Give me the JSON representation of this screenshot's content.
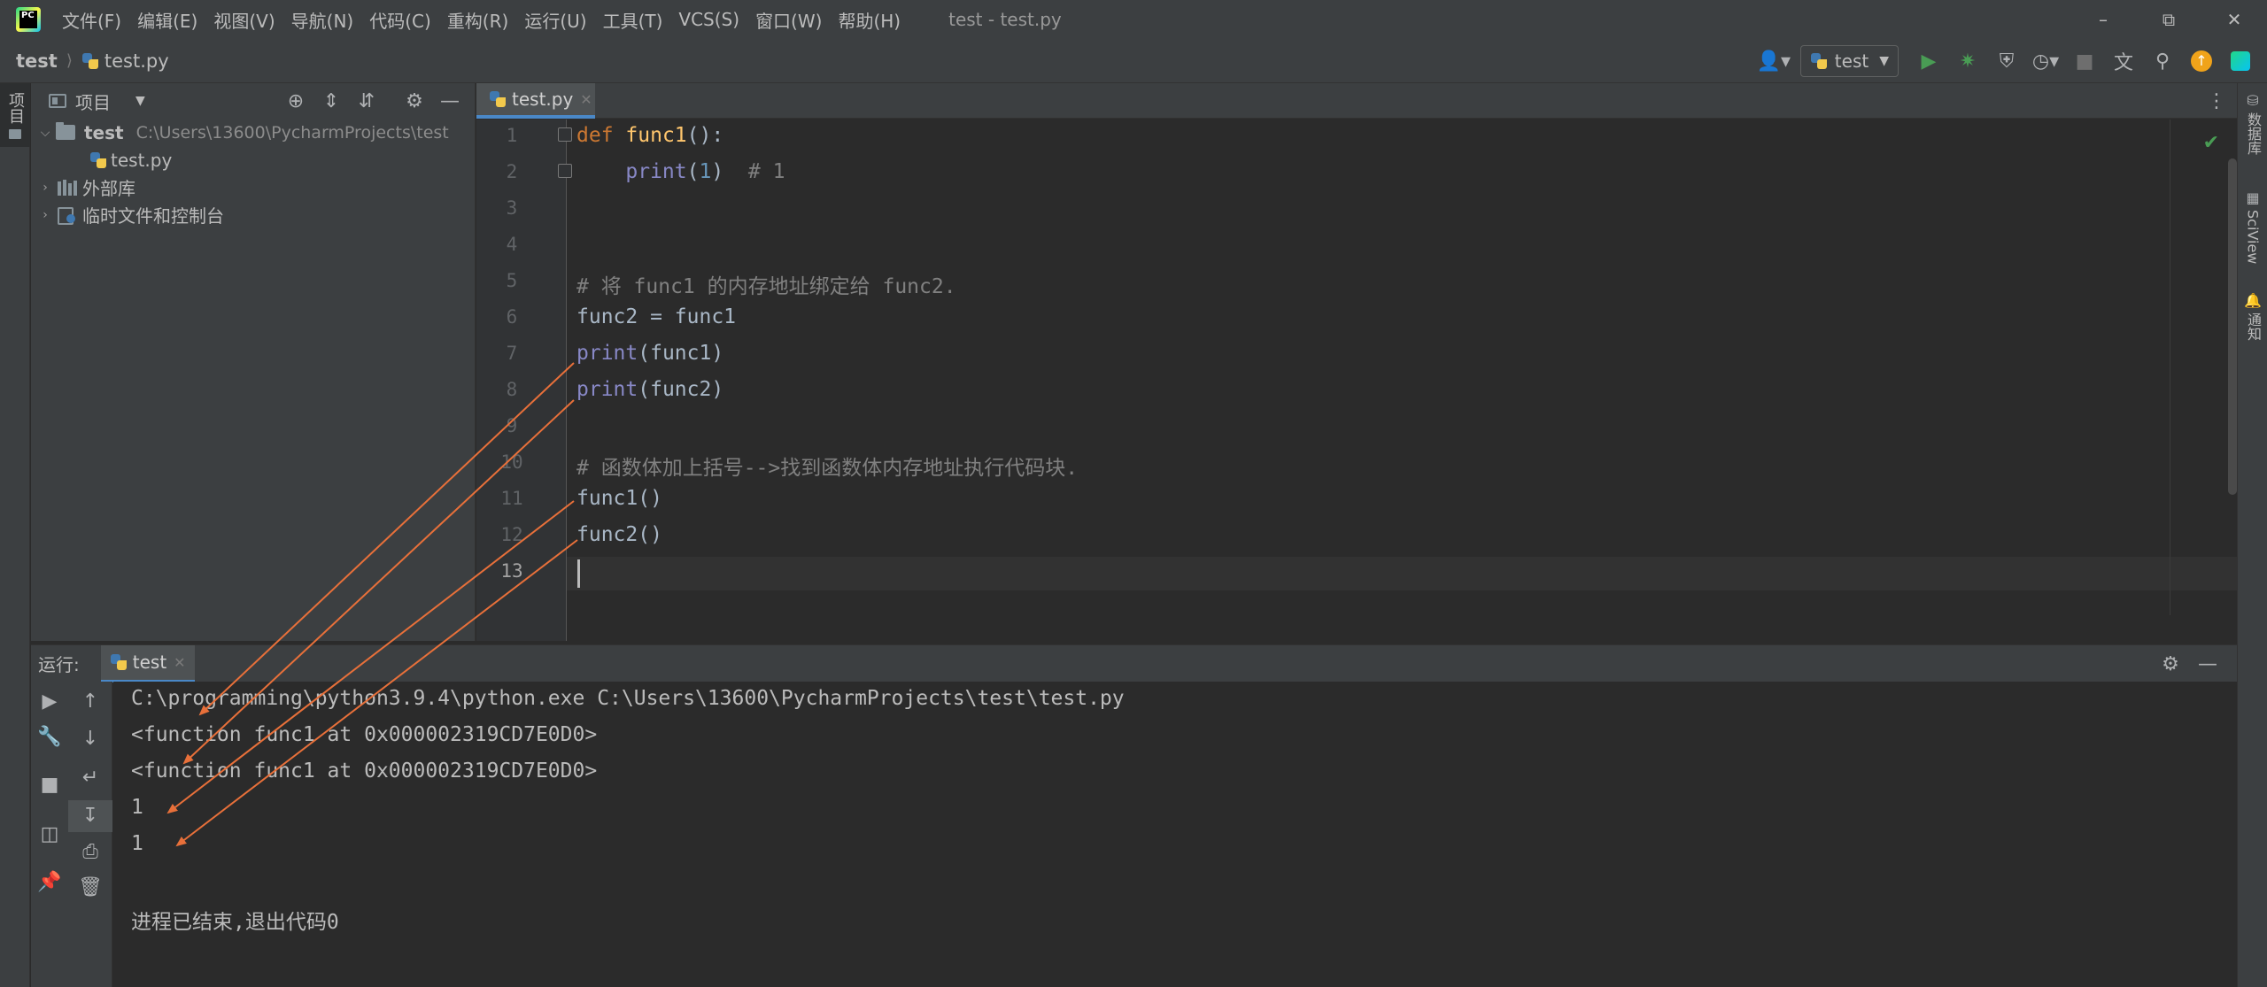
{
  "menubar": {
    "items": [
      "文件(F)",
      "编辑(E)",
      "视图(V)",
      "导航(N)",
      "代码(C)",
      "重构(R)",
      "运行(U)",
      "工具(T)",
      "VCS(S)",
      "窗口(W)",
      "帮助(H)"
    ],
    "window_title": "test - test.py"
  },
  "navbar": {
    "project": "test",
    "file": "test.py",
    "run_config": "test"
  },
  "left_strip": {
    "project_tab": "项目"
  },
  "right_strip": {
    "database": "数据库",
    "sciview": "SciView",
    "notifications": "通知"
  },
  "project_panel": {
    "title": "项目",
    "tree": {
      "root_name": "test",
      "root_path": "C:\\Users\\13600\\PycharmProjects\\test",
      "file": "test.py",
      "external_libs": "外部库",
      "scratches": "临时文件和控制台"
    }
  },
  "editor": {
    "tab": "test.py",
    "line_numbers": [
      "1",
      "2",
      "3",
      "4",
      "5",
      "6",
      "7",
      "8",
      "9",
      "10",
      "11",
      "12",
      "13"
    ],
    "code": {
      "l1_kw": "def",
      "l1_fn": "func1",
      "l1_rest": "():",
      "l2_indent": "    ",
      "l2_print": "print",
      "l2_open": "(",
      "l2_num": "1",
      "l2_close": ")",
      "l2_cmt": "  # 1",
      "l5_cmt": "# 将 func1 的内存地址绑定给 func2.",
      "l6": "func2 = func1",
      "l7_print": "print",
      "l7_rest": "(func1)",
      "l8_print": "print",
      "l8_rest": "(func2)",
      "l10_cmt": "# 函数体加上括号-->找到函数体内存地址执行代码块.",
      "l11": "func1()",
      "l12": "func2()"
    }
  },
  "run_panel": {
    "label": "运行:",
    "tab": "test",
    "output": [
      "C:\\programming\\python3.9.4\\python.exe C:\\Users\\13600\\PycharmProjects\\test\\test.py",
      "<function func1 at 0x000002319CD7E0D0>",
      "<function func1 at 0x000002319CD7E0D0>",
      "1",
      "1",
      "",
      "进程已结束,退出代码0"
    ]
  },
  "colors": {
    "accent": "#4a88c7",
    "annotation_arrow": "#e8703a",
    "run_green": "#499c54"
  }
}
